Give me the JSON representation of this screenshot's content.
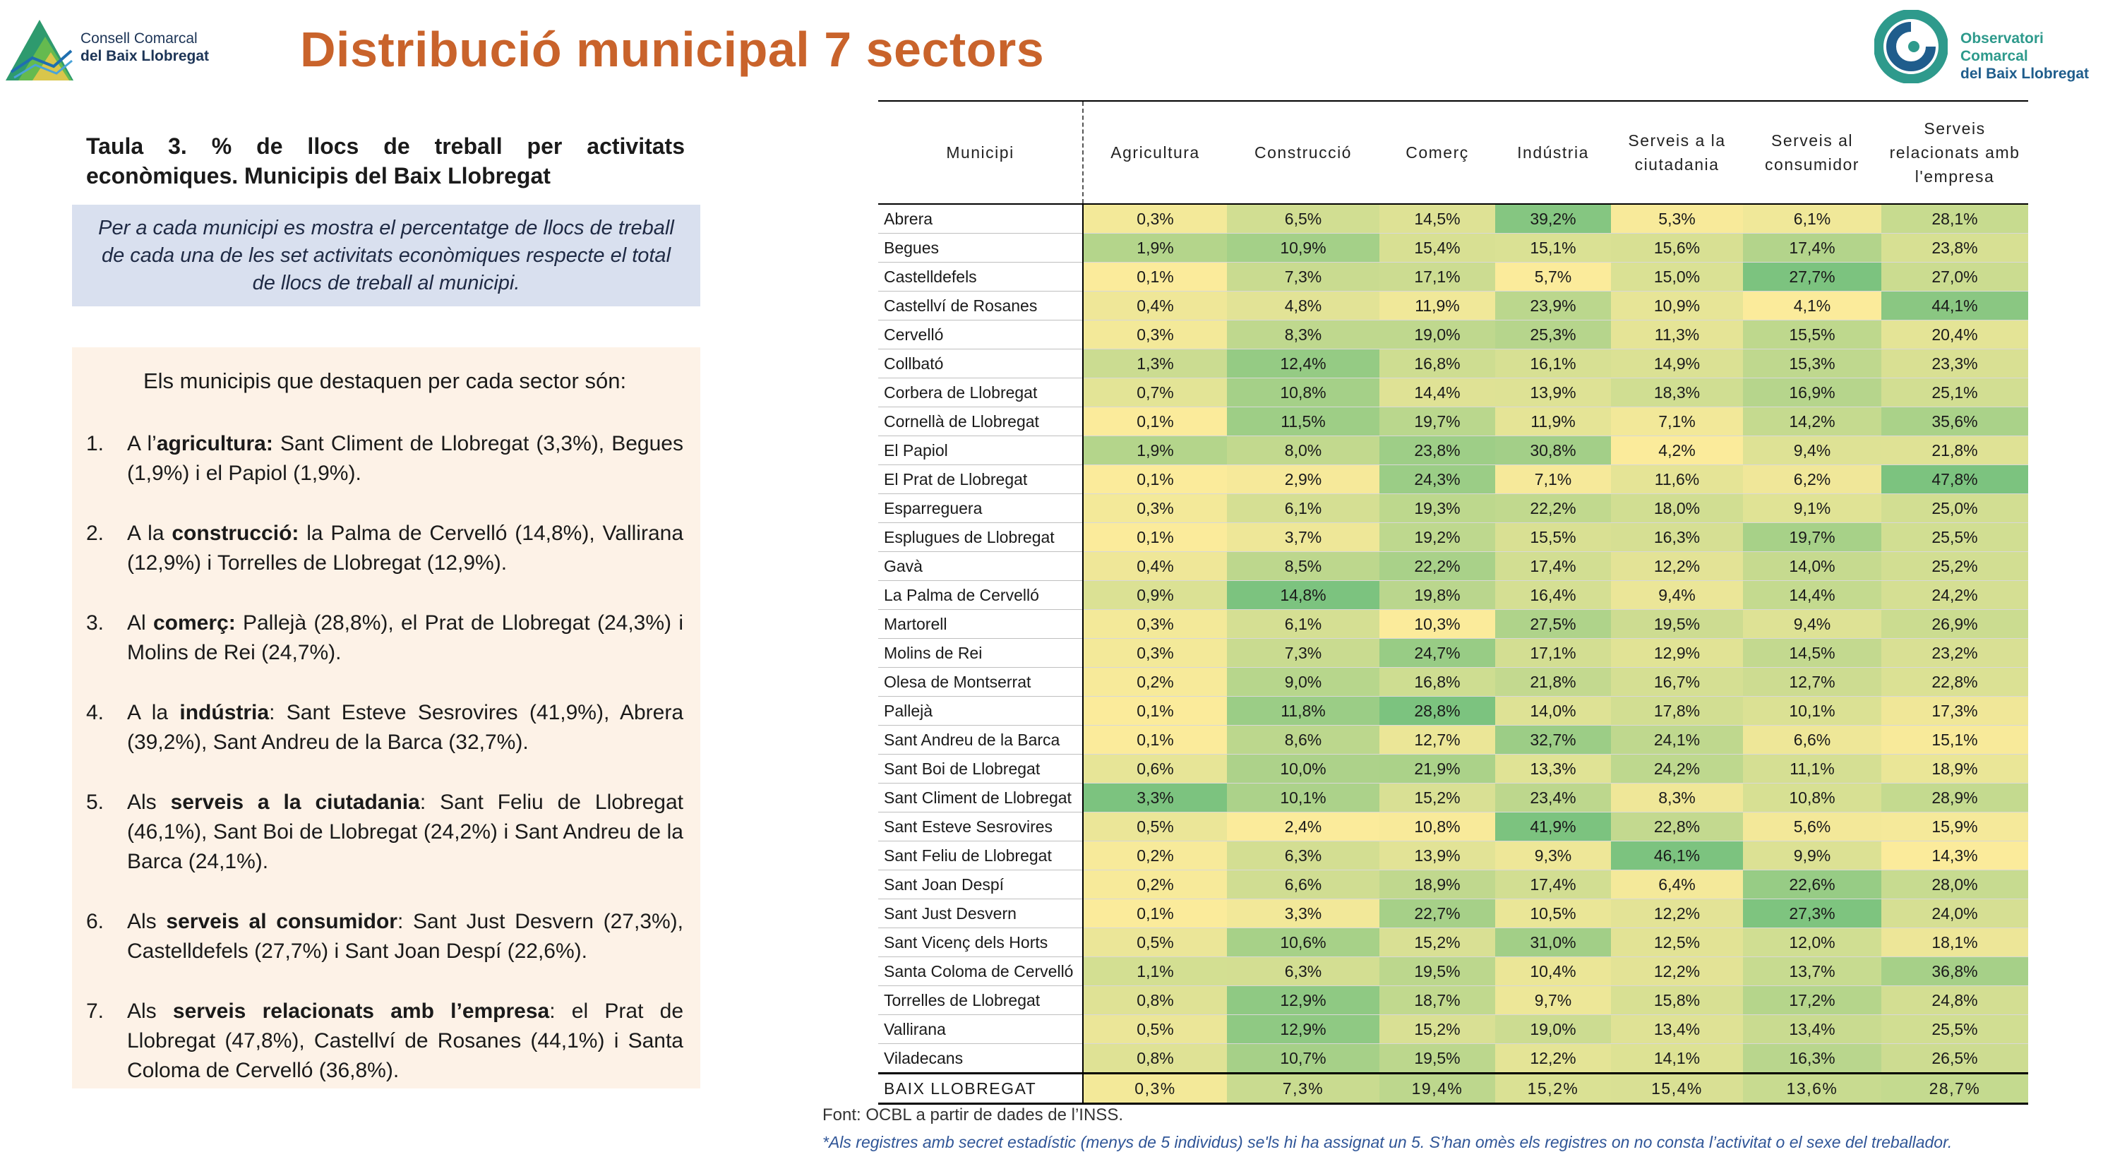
{
  "header": {
    "left_logo": {
      "line1": "Consell Comarcal",
      "line2": "del Baix Llobregat"
    },
    "title": "Distribució municipal 7 sectors",
    "right_logo": {
      "line1": "Observatori Comarcal",
      "line2": "del Baix Llobregat"
    }
  },
  "caption": "Taula 3. % de llocs de treball per activitats econòmiques. Municipis del Baix Llobregat",
  "intro": "Per a cada municipi es mostra el percentatge de llocs de treball de cada una de les set activitats econòmiques respecte el total de llocs de treball al municipi.",
  "highlights": {
    "heading": "Els municipis que destaquen per cada sector són:",
    "items": [
      {
        "num": "1.",
        "pre": "A l’",
        "bold": "agricultura:",
        "post": " Sant Climent de Llobregat (3,3%), Begues (1,9%) i el Papiol (1,9%)."
      },
      {
        "num": "2.",
        "pre": "A la ",
        "bold": "construcció:",
        "post": " la Palma de Cervelló (14,8%), Vallirana (12,9%) i Torrelles de Llobregat (12,9%)."
      },
      {
        "num": "3.",
        "pre": "Al ",
        "bold": "comerç:",
        "post": " Pallejà (28,8%), el Prat de Llobregat (24,3%) i Molins de Rei (24,7%)."
      },
      {
        "num": "4.",
        "pre": "A la ",
        "bold": "indústria",
        "post": ": Sant Esteve Sesrovires (41,9%), Abrera (39,2%), Sant Andreu de la Barca (32,7%)."
      },
      {
        "num": "5.",
        "pre": "Als ",
        "bold": "serveis a la ciutadania",
        "post": ": Sant Feliu de Llobregat (46,1%), Sant Boi de Llobregat (24,2%) i Sant Andreu de la Barca (24,1%)."
      },
      {
        "num": "6.",
        "pre": "Als ",
        "bold": "serveis al consumidor",
        "post": ": Sant Just Desvern (27,3%), Castelldefels (27,7%) i Sant Joan Despí (22,6%)."
      },
      {
        "num": "7.",
        "pre": "Als ",
        "bold": "serveis relacionats amb l’empresa",
        "post": ": el Prat de Llobregat (47,8%), Castellví de Rosanes (44,1%) i Santa Coloma de Cervelló (36,8%)."
      }
    ]
  },
  "table": {
    "headers": [
      "Municipi",
      "Agricultura",
      "Construcció",
      "Comerç",
      "Indústria",
      "Serveis a la ciutadania",
      "Serveis al consumidor",
      "Serveis relacionats amb l'empresa"
    ],
    "rows": [
      [
        "Abrera",
        "0,3%",
        "6,5%",
        "14,5%",
        "39,2%",
        "5,3%",
        "6,1%",
        "28,1%"
      ],
      [
        "Begues",
        "1,9%",
        "10,9%",
        "15,4%",
        "15,1%",
        "15,6%",
        "17,4%",
        "23,8%"
      ],
      [
        "Castelldefels",
        "0,1%",
        "7,3%",
        "17,1%",
        "5,7%",
        "15,0%",
        "27,7%",
        "27,0%"
      ],
      [
        "Castellví de Rosanes",
        "0,4%",
        "4,8%",
        "11,9%",
        "23,9%",
        "10,9%",
        "4,1%",
        "44,1%"
      ],
      [
        "Cervelló",
        "0,3%",
        "8,3%",
        "19,0%",
        "25,3%",
        "11,3%",
        "15,5%",
        "20,4%"
      ],
      [
        "Collbató",
        "1,3%",
        "12,4%",
        "16,8%",
        "16,1%",
        "14,9%",
        "15,3%",
        "23,3%"
      ],
      [
        "Corbera de Llobregat",
        "0,7%",
        "10,8%",
        "14,4%",
        "13,9%",
        "18,3%",
        "16,9%",
        "25,1%"
      ],
      [
        "Cornellà de Llobregat",
        "0,1%",
        "11,5%",
        "19,7%",
        "11,9%",
        "7,1%",
        "14,2%",
        "35,6%"
      ],
      [
        "El Papiol",
        "1,9%",
        "8,0%",
        "23,8%",
        "30,8%",
        "4,2%",
        "9,4%",
        "21,8%"
      ],
      [
        "El Prat de Llobregat",
        "0,1%",
        "2,9%",
        "24,3%",
        "7,1%",
        "11,6%",
        "6,2%",
        "47,8%"
      ],
      [
        "Esparreguera",
        "0,3%",
        "6,1%",
        "19,3%",
        "22,2%",
        "18,0%",
        "9,1%",
        "25,0%"
      ],
      [
        "Esplugues de Llobregat",
        "0,1%",
        "3,7%",
        "19,2%",
        "15,5%",
        "16,3%",
        "19,7%",
        "25,5%"
      ],
      [
        "Gavà",
        "0,4%",
        "8,5%",
        "22,2%",
        "17,4%",
        "12,2%",
        "14,0%",
        "25,2%"
      ],
      [
        "La Palma de Cervelló",
        "0,9%",
        "14,8%",
        "19,8%",
        "16,4%",
        "9,4%",
        "14,4%",
        "24,2%"
      ],
      [
        "Martorell",
        "0,3%",
        "6,1%",
        "10,3%",
        "27,5%",
        "19,5%",
        "9,4%",
        "26,9%"
      ],
      [
        "Molins de Rei",
        "0,3%",
        "7,3%",
        "24,7%",
        "17,1%",
        "12,9%",
        "14,5%",
        "23,2%"
      ],
      [
        "Olesa de Montserrat",
        "0,2%",
        "9,0%",
        "16,8%",
        "21,8%",
        "16,7%",
        "12,7%",
        "22,8%"
      ],
      [
        "Pallejà",
        "0,1%",
        "11,8%",
        "28,8%",
        "14,0%",
        "17,8%",
        "10,1%",
        "17,3%"
      ],
      [
        "Sant Andreu de la Barca",
        "0,1%",
        "8,6%",
        "12,7%",
        "32,7%",
        "24,1%",
        "6,6%",
        "15,1%"
      ],
      [
        "Sant Boi de Llobregat",
        "0,6%",
        "10,0%",
        "21,9%",
        "13,3%",
        "24,2%",
        "11,1%",
        "18,9%"
      ],
      [
        "Sant Climent de Llobregat",
        "3,3%",
        "10,1%",
        "15,2%",
        "23,4%",
        "8,3%",
        "10,8%",
        "28,9%"
      ],
      [
        "Sant Esteve Sesrovires",
        "0,5%",
        "2,4%",
        "10,8%",
        "41,9%",
        "22,8%",
        "5,6%",
        "15,9%"
      ],
      [
        "Sant Feliu de Llobregat",
        "0,2%",
        "6,3%",
        "13,9%",
        "9,3%",
        "46,1%",
        "9,9%",
        "14,3%"
      ],
      [
        "Sant Joan Despí",
        "0,2%",
        "6,6%",
        "18,9%",
        "17,4%",
        "6,4%",
        "22,6%",
        "28,0%"
      ],
      [
        "Sant Just Desvern",
        "0,1%",
        "3,3%",
        "22,7%",
        "10,5%",
        "12,2%",
        "27,3%",
        "24,0%"
      ],
      [
        "Sant Vicenç dels Horts",
        "0,5%",
        "10,6%",
        "15,2%",
        "31,0%",
        "12,5%",
        "12,0%",
        "18,1%"
      ],
      [
        "Santa Coloma de Cervelló",
        "1,1%",
        "6,3%",
        "19,5%",
        "10,4%",
        "12,2%",
        "13,7%",
        "36,8%"
      ],
      [
        "Torrelles de Llobregat",
        "0,8%",
        "12,9%",
        "18,7%",
        "9,7%",
        "15,8%",
        "17,2%",
        "24,8%"
      ],
      [
        "Vallirana",
        "0,5%",
        "12,9%",
        "15,2%",
        "19,0%",
        "13,4%",
        "13,4%",
        "25,5%"
      ],
      [
        "Viladecans",
        "0,8%",
        "10,7%",
        "19,5%",
        "12,2%",
        "14,1%",
        "16,3%",
        "26,5%"
      ]
    ],
    "total": [
      "BAIX LLOBREGAT",
      "0,3%",
      "7,3%",
      "19,4%",
      "15,2%",
      "15,4%",
      "13,6%",
      "28,7%"
    ],
    "colors": {
      "low": "#fbeb9b",
      "high": "#7cc37f"
    }
  },
  "source": "Font: OCBL a partir de dades de l’INSS.",
  "footnote": "*Als registres amb secret estadístic (menys de 5 individus) se'ls hi ha assignat un 5. S’han omès els registres on no consta l’activitat o el sexe del treballador."
}
